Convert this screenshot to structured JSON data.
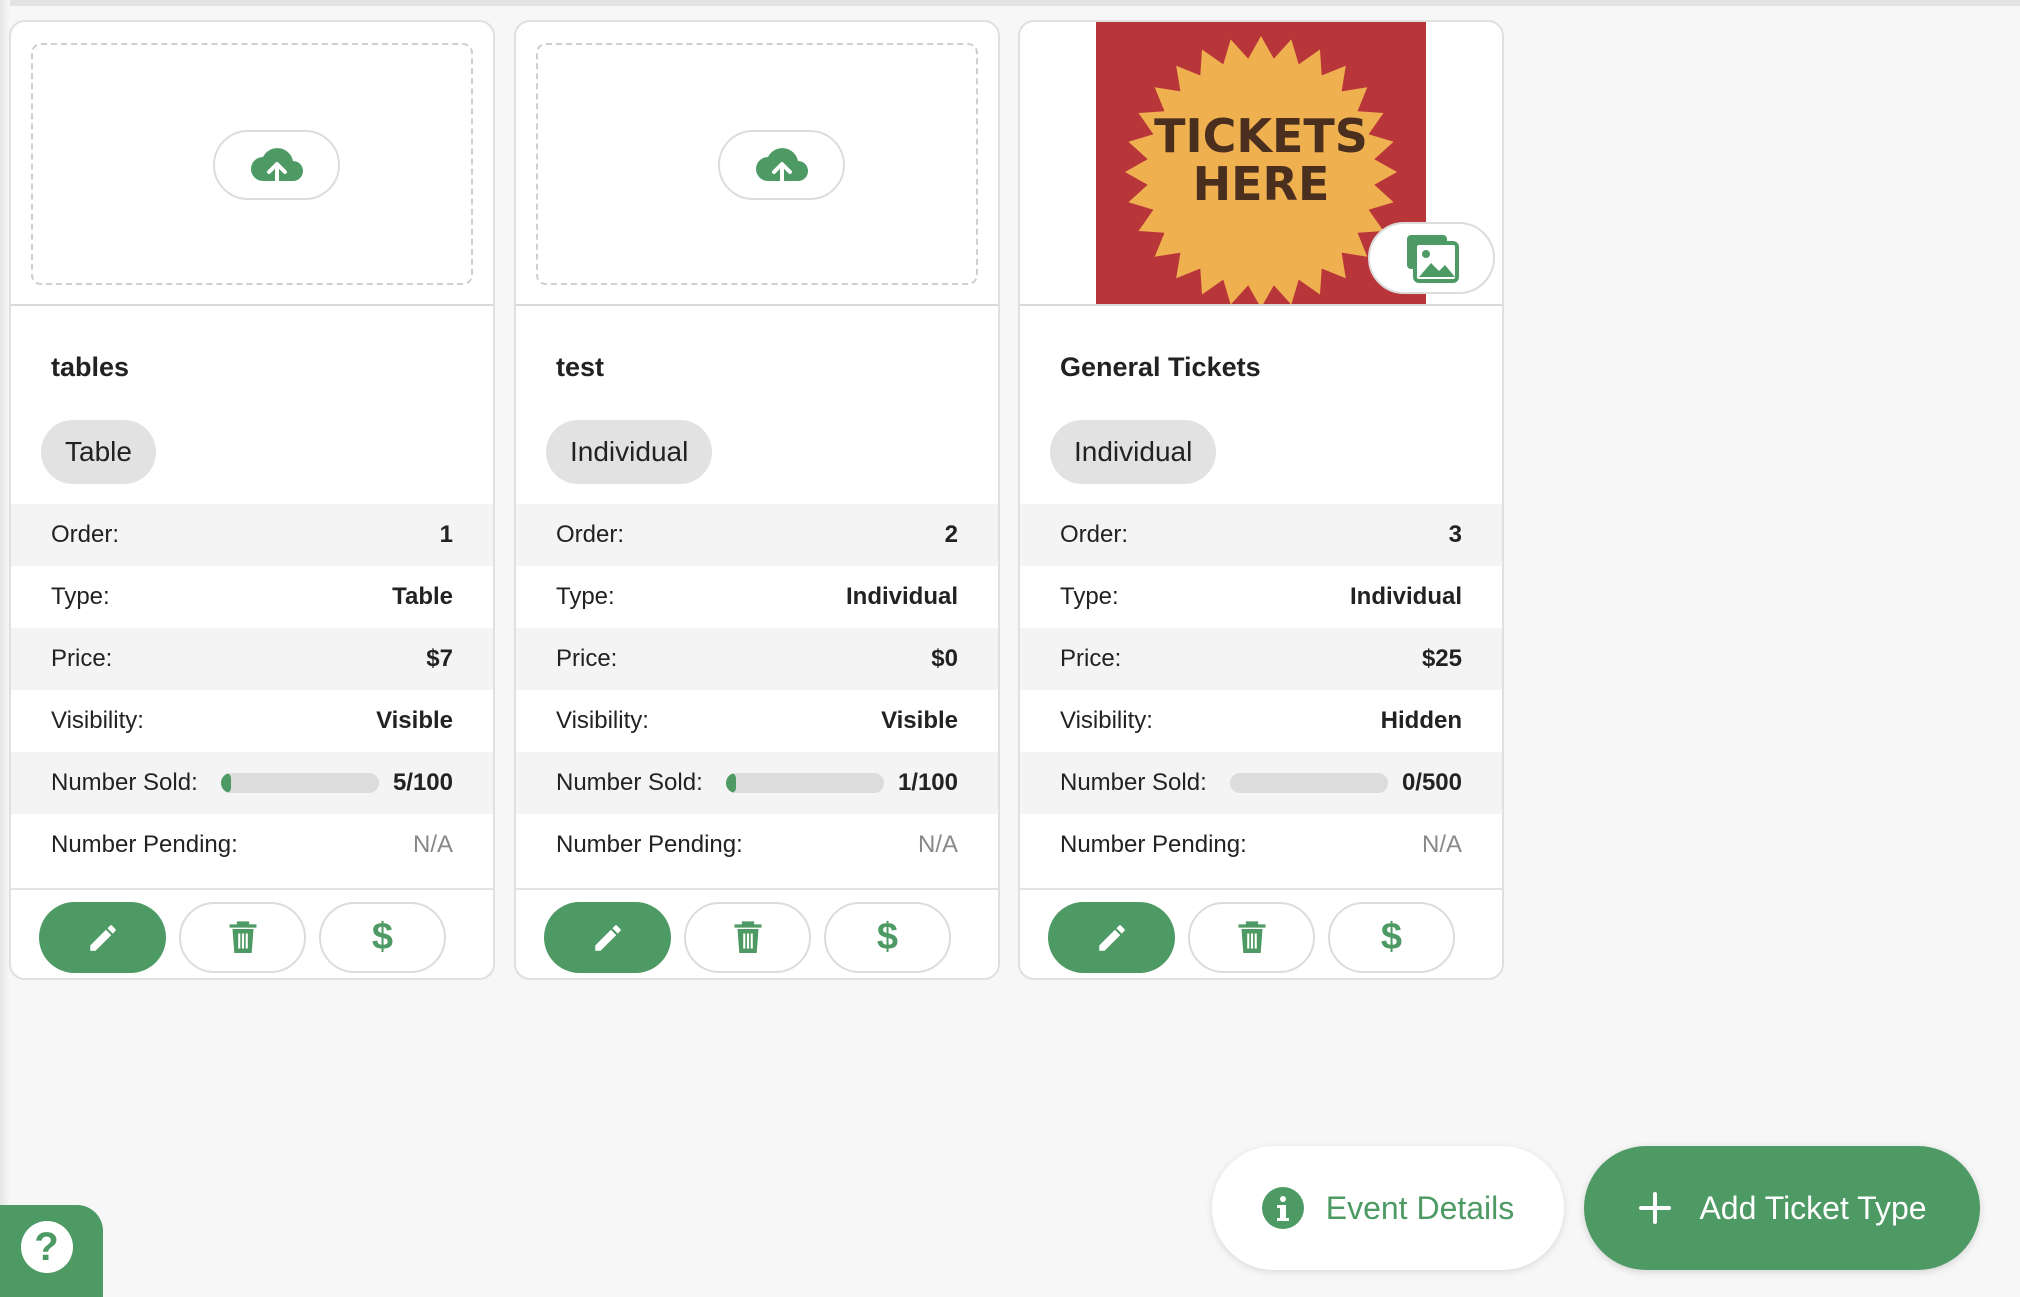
{
  "cards": [
    {
      "name": "tables",
      "chip": "Table",
      "has_image": false,
      "rows": [
        {
          "label": "Order:",
          "value": "1"
        },
        {
          "label": "Type:",
          "value": "Table"
        },
        {
          "label": "Price:",
          "value": "$7"
        },
        {
          "label": "Visibility:",
          "value": "Visible"
        },
        {
          "label": "Number Sold:",
          "value": "5/100",
          "progress": 0.05
        },
        {
          "label": "Number Pending:",
          "value": "N/A"
        }
      ]
    },
    {
      "name": "test",
      "chip": "Individual",
      "has_image": false,
      "rows": [
        {
          "label": "Order:",
          "value": "2"
        },
        {
          "label": "Type:",
          "value": "Individual"
        },
        {
          "label": "Price:",
          "value": "$0"
        },
        {
          "label": "Visibility:",
          "value": "Visible"
        },
        {
          "label": "Number Sold:",
          "value": "1/100",
          "progress": 0.01
        },
        {
          "label": "Number Pending:",
          "value": "N/A"
        }
      ]
    },
    {
      "name": "General Tickets",
      "chip": "Individual",
      "has_image": true,
      "image_text": [
        "TICKETS",
        "HERE"
      ],
      "rows": [
        {
          "label": "Order:",
          "value": "3"
        },
        {
          "label": "Type:",
          "value": "Individual"
        },
        {
          "label": "Price:",
          "value": "$25"
        },
        {
          "label": "Visibility:",
          "value": "Hidden"
        },
        {
          "label": "Number Sold:",
          "value": "0/500",
          "progress": 0.0
        },
        {
          "label": "Number Pending:",
          "value": "N/A"
        }
      ]
    }
  ],
  "actions": {
    "pay_symbol": "$"
  },
  "footer": {
    "event_details_label": "Event Details",
    "add_ticket_label": "Add Ticket Type",
    "help_symbol": "?"
  },
  "colors": {
    "accent": "#4e9a64",
    "image_bg": "#b8363a",
    "image_burst": "#efb04f"
  }
}
